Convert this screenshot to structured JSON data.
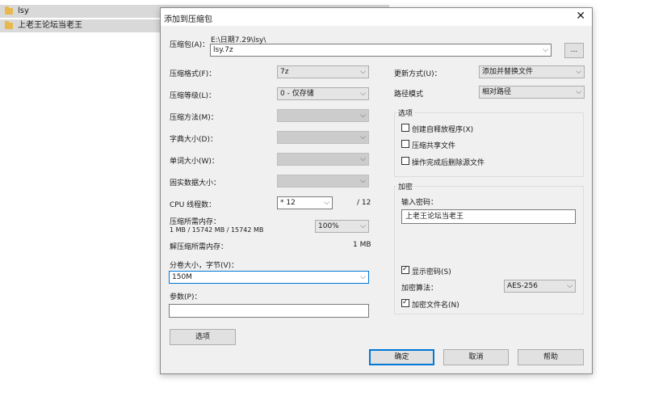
{
  "background_list": {
    "items": [
      "lsy",
      "上老王论坛当老王"
    ]
  },
  "dialog": {
    "title": "添加到压缩包",
    "close_glyph": "✕",
    "archive_label": "压缩包(A)：",
    "archive_path": "E:\\日期7.29\\lsy\\",
    "archive_name": "lsy.7z",
    "browse_label": "...",
    "format_label": "压缩格式(F)：",
    "format_value": "7z",
    "level_label": "压缩等级(L)：",
    "level_value": "0 - 仅存储",
    "method_label": "压缩方法(M)：",
    "dict_label": "字典大小(D)：",
    "word_label": "单词大小(W)：",
    "solid_label": "固实数据大小：",
    "cpu_label": "CPU 线程数：",
    "cpu_value": "* 12",
    "cpu_total": "/ 12",
    "mem_label": "压缩所需内存：",
    "mem_detail": "1 MB / 15742 MB / 15742 MB",
    "mem_percent": "100%",
    "decomp_label": "解压缩所需内存：",
    "decomp_value": "1 MB",
    "volume_label": "分卷大小，字节(V)：",
    "volume_value": "150M",
    "params_label": "参数(P)：",
    "params_value": "",
    "options_button": "选项",
    "update_label": "更新方式(U)：",
    "update_value": "添加并替换文件",
    "path_mode_label": "路径模式",
    "path_mode_value": "相对路径",
    "options_group": "选项",
    "opt_sfx": "创建自释放程序(X)",
    "opt_shared": "压缩共享文件",
    "opt_delete": "操作完成后删除源文件",
    "encrypt_group": "加密",
    "password_label": "输入密码：",
    "password_value": "上老王论坛当老王",
    "show_password": "显示密码(S)",
    "enc_method_label": "加密算法：",
    "enc_method_value": "AES-256",
    "encrypt_names": "加密文件名(N)",
    "ok": "确定",
    "cancel": "取消",
    "help": "帮助",
    "checks": {
      "sfx": false,
      "shared": false,
      "delete": false,
      "show_password": true,
      "encrypt_names": true
    }
  }
}
